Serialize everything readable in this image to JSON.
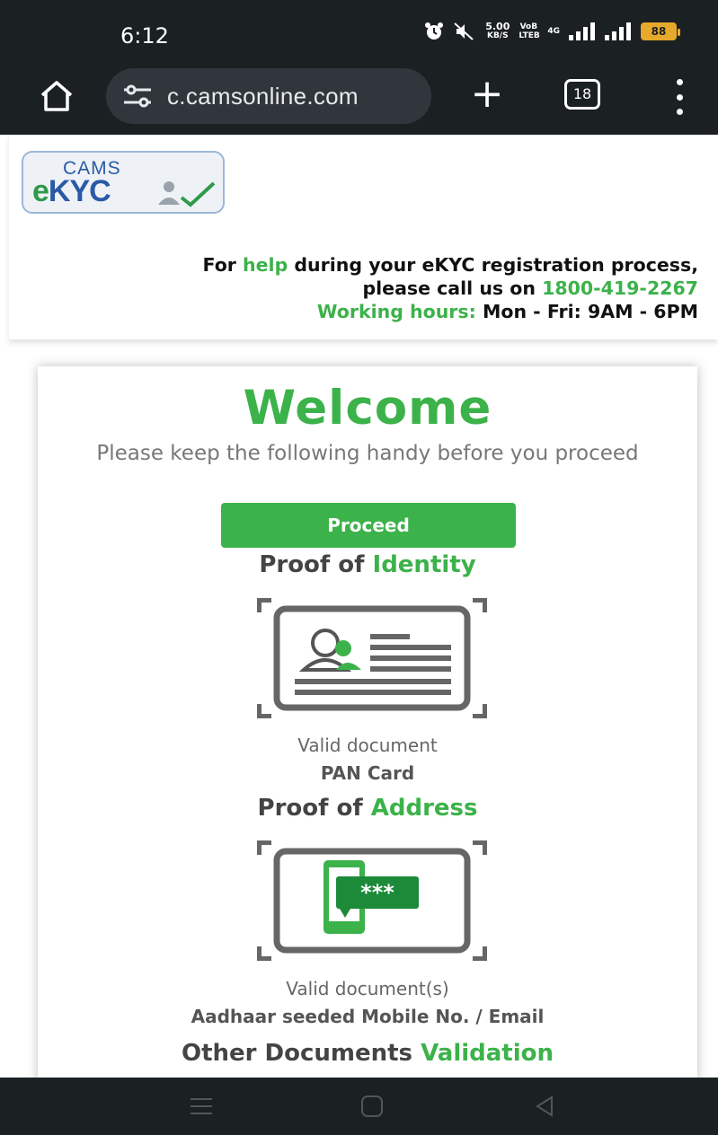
{
  "status_bar": {
    "time": "6:12",
    "net_speed": "5.00",
    "net_unit": "KB/S",
    "volte": "VoB LTEB",
    "network": "4G",
    "battery": "88",
    "icons": [
      "alarm-icon",
      "mute-icon",
      "signal-icon",
      "signal-icon"
    ]
  },
  "browser": {
    "url": "c.camsonline.com",
    "tab_count": "18",
    "new_tab": "+"
  },
  "header": {
    "logo_top": "CAMS",
    "logo_main_e": "e",
    "logo_main_k": "KYC",
    "help_line1_pre": "For ",
    "help_word": "help",
    "help_line1_post": " during your eKYC registration process,",
    "help_line2_pre": "please call us on ",
    "phone": "1800-419-2267",
    "hours_label": "Working hours:",
    "hours_value": " Mon - Fri: 9AM - 6PM"
  },
  "card": {
    "welcome": "Welcome",
    "instruction": "Please keep the following handy before you proceed",
    "proceed_label": "Proceed",
    "identity": {
      "title_pre": "Proof of ",
      "title_accent": "Identity",
      "label": "Valid document",
      "value": "PAN Card"
    },
    "address": {
      "title_pre": "Proof of ",
      "title_accent": "Address",
      "label": "Valid document(s)",
      "value": "Aadhaar seeded Mobile No. / Email",
      "otp_text": "***"
    },
    "other": {
      "title_pre": "Other Documents ",
      "title_accent": "Validation"
    }
  },
  "colors": {
    "accent_green": "#3cb24a",
    "bar_dark": "#1b2023",
    "battery": "#e6a92b"
  }
}
